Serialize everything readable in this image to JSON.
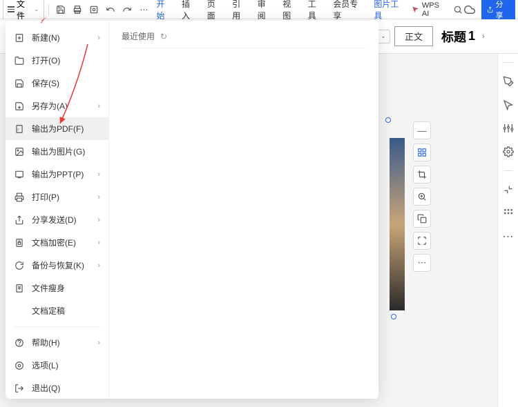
{
  "topbar": {
    "file_label": "文件"
  },
  "tabs": {
    "start": "开始",
    "insert": "插入",
    "page": "页面",
    "reference": "引用",
    "review": "审阅",
    "view": "视图",
    "tools": "工具",
    "member": "会员专享",
    "pic_tools": "图片工具"
  },
  "ai_label": "WPS AI",
  "share_label": "分享",
  "ribbon": {
    "style_body": "正文",
    "style_title": "标题",
    "style_title_num": "1"
  },
  "file_menu": {
    "new": "新建(N)",
    "open": "打开(O)",
    "save": "保存(S)",
    "save_as": "另存为(A)",
    "export_pdf": "输出为PDF(F)",
    "export_img": "输出为图片(G)",
    "export_ppt": "输出为PPT(P)",
    "print": "打印(P)",
    "share_send": "分享发送(D)",
    "encrypt": "文档加密(E)",
    "backup": "备份与恢复(K)",
    "slim": "文件瘦身",
    "finalize": "文档定稿",
    "help": "帮助(H)",
    "options": "选项(L)",
    "exit": "退出(Q)"
  },
  "recent_label": "最近使用"
}
